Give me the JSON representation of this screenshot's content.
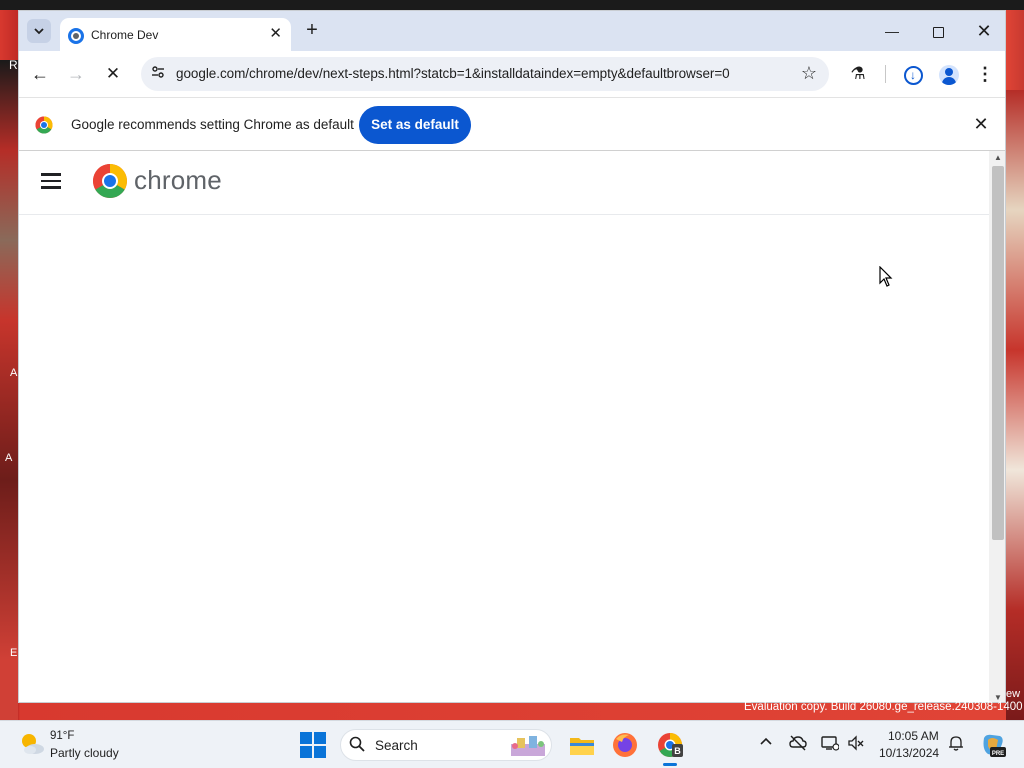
{
  "desktop": {
    "edge_letters": [
      "R",
      "A",
      "A",
      "E"
    ],
    "watermark": "Evaluation copy. Build 26080.ge_release.240308-1400",
    "edge_fragment": "ew"
  },
  "browser": {
    "tab": {
      "title": "Chrome Dev",
      "close": "✕"
    },
    "new_tab": "+",
    "window_controls": {
      "minimize": "—",
      "close": "✕"
    },
    "toolbar": {
      "back": "←",
      "forward": "→",
      "stop": "✕",
      "url": "google.com/chrome/dev/next-steps.html?statcb=1&installdataindex=empty&defaultbrowser=0",
      "star": "☆",
      "labs": "⚗",
      "download": "↓",
      "menu": "⋮"
    },
    "infobar": {
      "message": "Google recommends setting Chrome as default",
      "button": "Set as default",
      "close": "✕"
    },
    "page": {
      "brand": "chrome"
    },
    "colors": {
      "accent": "#0b57d0",
      "tabstrip": "#dbe3f2",
      "omnibox": "#edf0f6"
    }
  },
  "taskbar": {
    "weather": {
      "temp": "91°F",
      "desc": "Partly cloudy"
    },
    "search": {
      "placeholder": "Search",
      "icon": "search-icon"
    },
    "apps": [
      "start-icon",
      "file-explorer-icon",
      "firefox-icon",
      "chrome-dev-icon"
    ],
    "tray": {
      "chevron": "^",
      "time": "10:05 AM",
      "date": "10/13/2024",
      "bell": "🔔"
    }
  }
}
